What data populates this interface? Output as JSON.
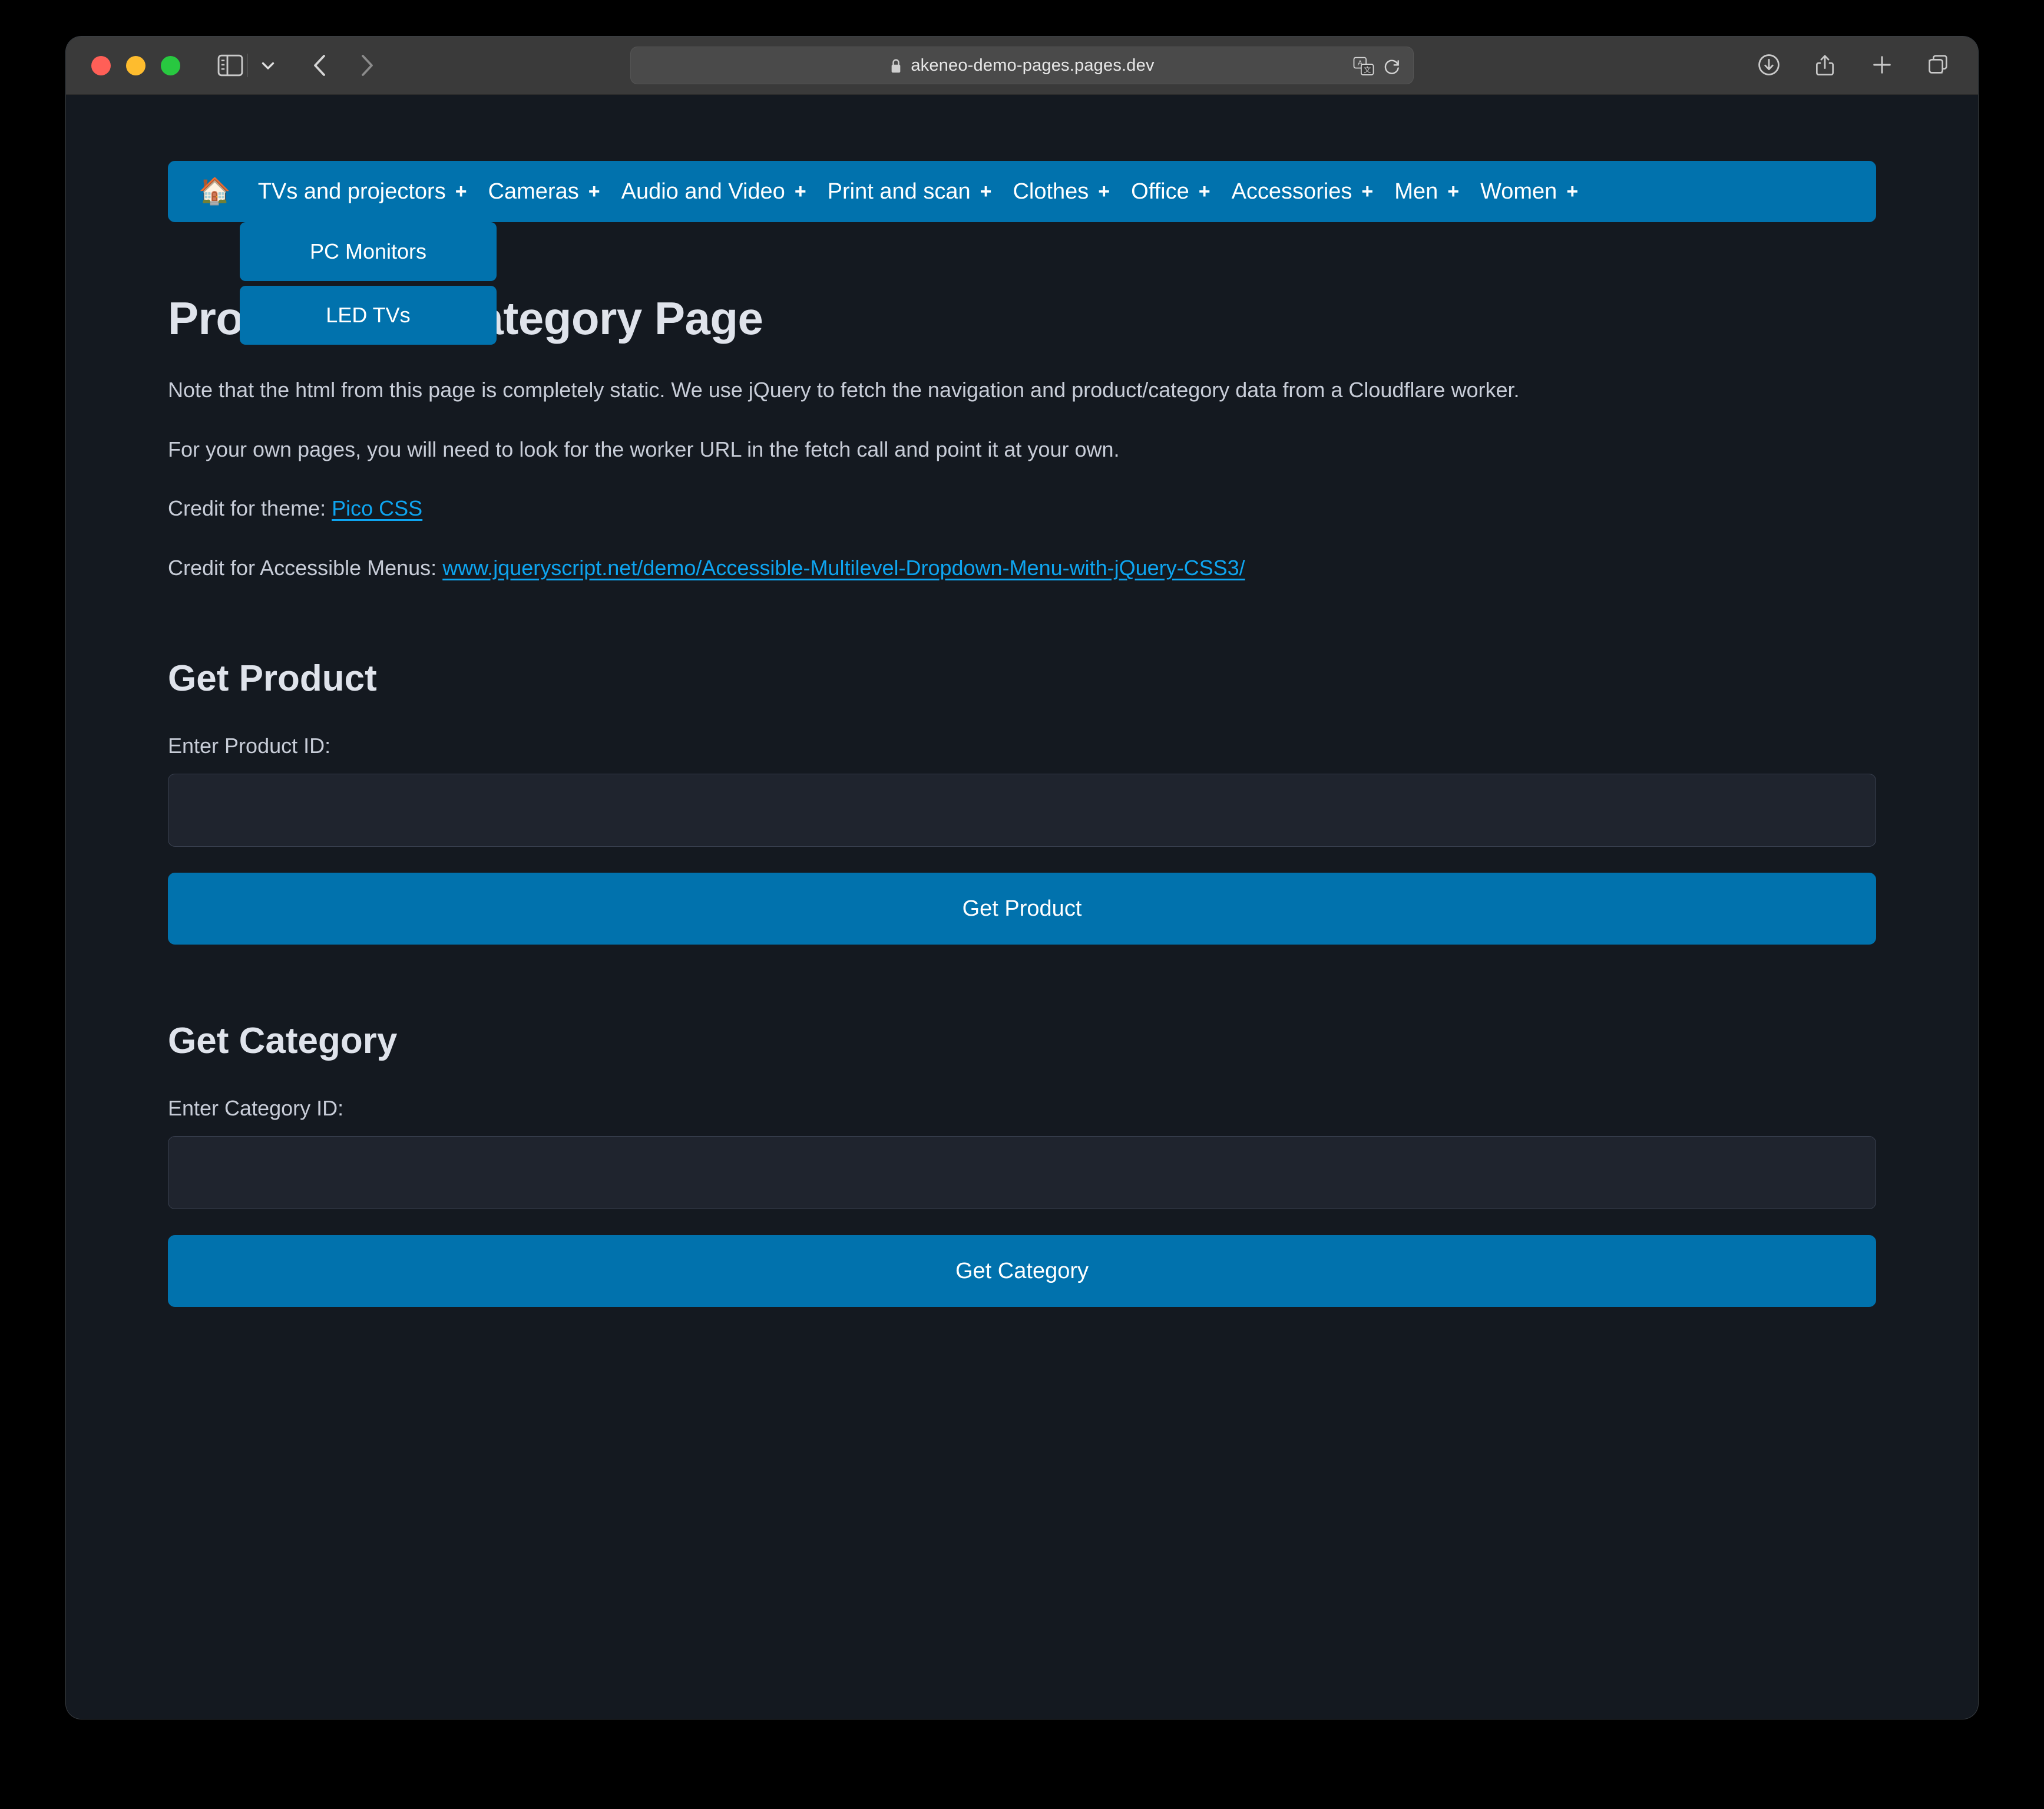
{
  "browser": {
    "address": "akeneo-demo-pages.pages.dev",
    "icons": {
      "lock": "lock-icon",
      "sidebar": "sidebar-toggle-icon",
      "tabs_chevron": "chevron-down-icon",
      "back": "back-arrow-icon",
      "forward": "forward-arrow-icon",
      "translate": "translate-icon",
      "reload": "reload-icon",
      "downloads": "downloads-icon",
      "share": "share-icon",
      "new_tab": "plus-icon",
      "tab_overview": "tab-overview-icon"
    }
  },
  "nav": {
    "home_icon": "🏠",
    "items": [
      {
        "label": "TVs and projectors",
        "expander": "+"
      },
      {
        "label": "Cameras",
        "expander": "+"
      },
      {
        "label": "Audio and Video",
        "expander": "+"
      },
      {
        "label": "Print and scan",
        "expander": "+"
      },
      {
        "label": "Clothes",
        "expander": "+"
      },
      {
        "label": "Office",
        "expander": "+"
      },
      {
        "label": "Accessories",
        "expander": "+"
      },
      {
        "label": "Men",
        "expander": "+"
      },
      {
        "label": "Women",
        "expander": "+"
      }
    ],
    "dropdown": {
      "parent": "TVs and projectors",
      "items": [
        {
          "label": "PC Monitors"
        },
        {
          "label": "LED TVs"
        }
      ]
    }
  },
  "main": {
    "title": "Product and Category Page",
    "paragraphs": [
      "Note that the html from this page is completely static. We use jQuery to fetch the navigation and product/category data from a Cloudflare worker.",
      "For your own pages, you will need to look for the worker URL in the fetch call and point it at your own."
    ],
    "credits": [
      {
        "prefix": "Credit for theme: ",
        "link_text": "Pico CSS"
      },
      {
        "prefix": "Credit for Accessible Menus: ",
        "link_text": "www.jqueryscript.net/demo/Accessible-Multilevel-Dropdown-Menu-with-jQuery-CSS3/"
      }
    ],
    "sections": [
      {
        "heading": "Get Product",
        "label": "Enter Product ID:",
        "input_value": "",
        "input_placeholder": "",
        "button": "Get Product"
      },
      {
        "heading": "Get Category",
        "label": "Enter Category ID:",
        "input_value": "",
        "input_placeholder": "",
        "button": "Get Category"
      }
    ]
  },
  "colors": {
    "accent": "#0172ad",
    "link": "#0ea5f0",
    "page_background": "#141920",
    "text": "#dfe3eb"
  }
}
